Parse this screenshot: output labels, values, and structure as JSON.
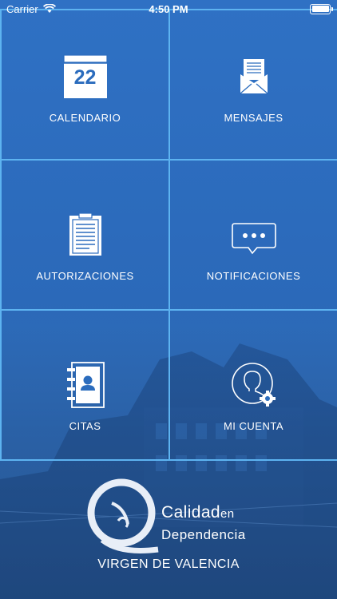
{
  "status_bar": {
    "carrier": "Carrier",
    "time": "4:50 PM"
  },
  "menu": {
    "calendar": {
      "label": "CALENDARIO",
      "date_number": "22"
    },
    "messages": {
      "label": "MENSAJES"
    },
    "authorizations": {
      "label": "AUTORIZACIONES"
    },
    "notifications": {
      "label": "NOTIFICACIONES"
    },
    "appointments": {
      "label": "CITAS"
    },
    "account": {
      "label": "MI CUENTA"
    }
  },
  "branding": {
    "line1": "Calidad",
    "line1_suffix": "en",
    "line2": "Dependencia",
    "residence_name": "VIRGEN DE VALENCIA"
  },
  "icons": {
    "calendar": "calendar-icon",
    "messages": "envelope-icon",
    "authorizations": "clipboard-icon",
    "notifications": "speech-bubble-icon",
    "appointments": "address-book-icon",
    "account": "user-settings-icon"
  },
  "colors": {
    "background": "#2b6cbd",
    "grid_border": "#5db3f0",
    "icon_white": "#ffffff"
  }
}
